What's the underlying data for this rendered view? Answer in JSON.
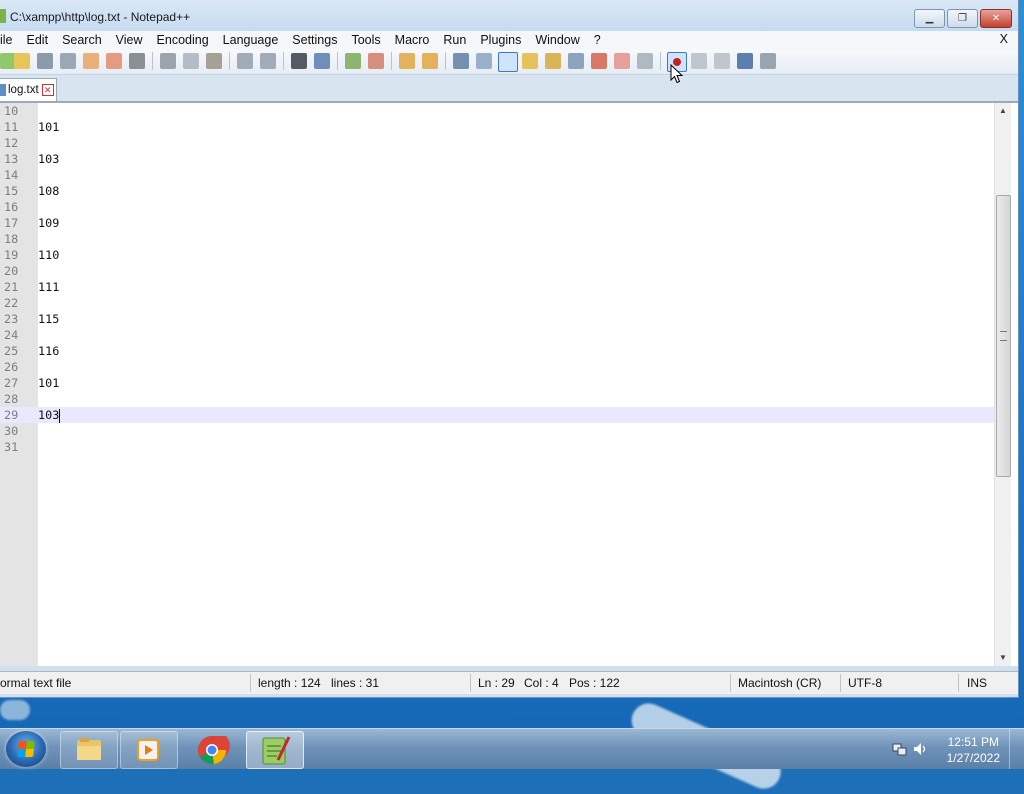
{
  "window": {
    "title": "C:\\xampp\\http\\log.txt - Notepad++"
  },
  "menu": {
    "items": [
      "ile",
      "Edit",
      "Search",
      "View",
      "Encoding",
      "Language",
      "Settings",
      "Tools",
      "Macro",
      "Run",
      "Plugins",
      "Window",
      "?"
    ],
    "close_label": "X"
  },
  "toolbar": {
    "buttons": [
      "new-file-icon",
      "open-file-icon",
      "save-icon",
      "save-all-icon",
      "close-icon",
      "close-all-icon",
      "print-icon",
      "cut-icon",
      "copy-icon",
      "paste-icon",
      "undo-icon",
      "redo-icon",
      "find-icon",
      "replace-icon",
      "zoom-in-icon",
      "zoom-out-icon",
      "sync-vertical-icon",
      "sync-horizontal-icon",
      "word-wrap-icon",
      "show-all-characters-icon",
      "indent-guide-icon",
      "user-language-icon",
      "doc-map-icon",
      "function-list-icon",
      "folder-as-workspace-icon",
      "doc-list-icon",
      "monitoring-icon",
      "record-macro-icon",
      "stop-recording-icon",
      "play-macro-icon",
      "run-macro-multiple-icon",
      "save-macro-icon"
    ],
    "selected": "indent-guide-icon"
  },
  "tab": {
    "label": "log.txt"
  },
  "editor": {
    "lines": [
      {
        "num": "10",
        "text": ""
      },
      {
        "num": "11",
        "text": "101"
      },
      {
        "num": "12",
        "text": ""
      },
      {
        "num": "13",
        "text": "103"
      },
      {
        "num": "14",
        "text": ""
      },
      {
        "num": "15",
        "text": "108"
      },
      {
        "num": "16",
        "text": ""
      },
      {
        "num": "17",
        "text": "109"
      },
      {
        "num": "18",
        "text": ""
      },
      {
        "num": "19",
        "text": "110"
      },
      {
        "num": "20",
        "text": ""
      },
      {
        "num": "21",
        "text": "111"
      },
      {
        "num": "22",
        "text": ""
      },
      {
        "num": "23",
        "text": "115"
      },
      {
        "num": "24",
        "text": ""
      },
      {
        "num": "25",
        "text": "116"
      },
      {
        "num": "26",
        "text": ""
      },
      {
        "num": "27",
        "text": "101"
      },
      {
        "num": "28",
        "text": ""
      },
      {
        "num": "29",
        "text": "103"
      },
      {
        "num": "30",
        "text": ""
      },
      {
        "num": "31",
        "text": ""
      }
    ],
    "current_line": "29"
  },
  "status": {
    "file_type": "ormal text file",
    "length": "length : 124",
    "lines": "lines : 31",
    "ln": "Ln : 29",
    "col": "Col : 4",
    "pos": "Pos : 122",
    "eol": "Macintosh (CR)",
    "encoding": "UTF-8",
    "mode": "INS"
  },
  "taskbar": {
    "apps": [
      "file-explorer-icon",
      "media-player-icon",
      "chrome-icon",
      "notepad-plus-plus-icon"
    ],
    "active_app": "notepad-plus-plus-icon",
    "clock_time": "12:51 PM",
    "clock_date": "1/27/2022"
  }
}
